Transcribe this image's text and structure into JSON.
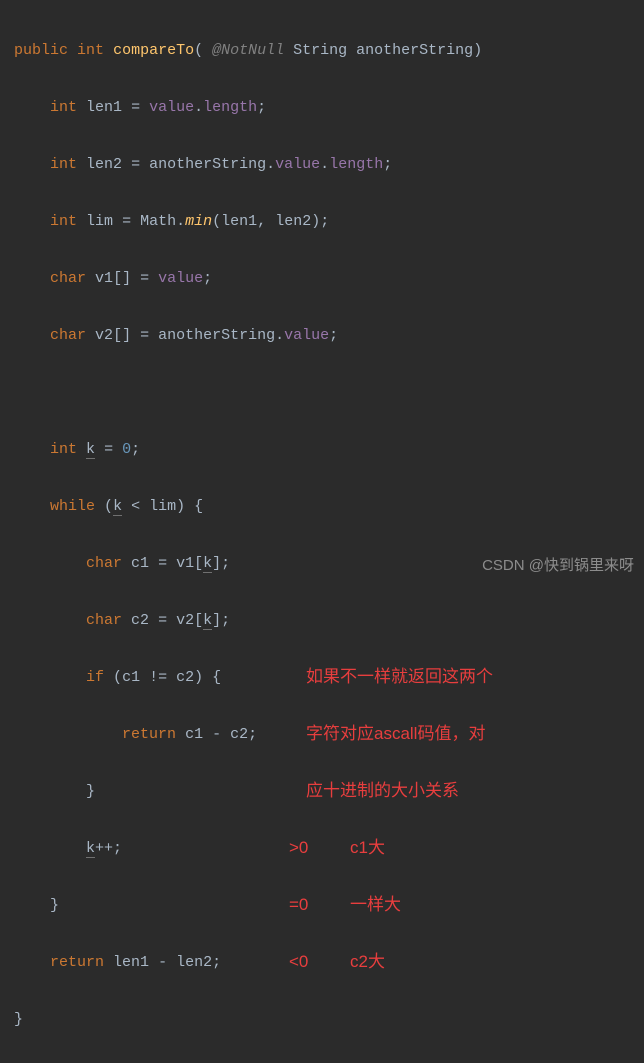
{
  "code": {
    "sig": {
      "public": "public",
      "int": "int",
      "name": "compareTo",
      "anno": "@NotNull",
      "ptype": "String",
      "pname": "anotherString"
    },
    "l1": {
      "type": "int",
      "var": "len1",
      "field": "value",
      "prop": "length"
    },
    "l2": {
      "type": "int",
      "var": "len2",
      "p": "anotherString",
      "field": "value",
      "prop": "length"
    },
    "l3": {
      "type": "int",
      "var": "lim",
      "cls": "Math",
      "m": "min",
      "a1": "len1",
      "a2": "len2"
    },
    "l4": {
      "type": "char",
      "var": "v1",
      "field": "value"
    },
    "l5": {
      "type": "char",
      "var": "v2",
      "p": "anotherString",
      "field": "value"
    },
    "l6": {
      "type": "int",
      "var": "k",
      "val": "0"
    },
    "l7": {
      "kw": "while",
      "var": "k",
      "limv": "lim"
    },
    "l8": {
      "type": "char",
      "var": "c1",
      "arr": "v1",
      "idx": "k"
    },
    "l9": {
      "type": "char",
      "var": "c2",
      "arr": "v2",
      "idx": "k"
    },
    "l10": {
      "kw": "if",
      "a": "c1",
      "b": "c2"
    },
    "l11": {
      "kw": "return",
      "a": "c1",
      "b": "c2"
    },
    "l12": {
      "var": "k"
    },
    "l13": {
      "kw": "return",
      "a": "len1",
      "b": "len2"
    }
  },
  "notes": {
    "n1": "如果不一样就返回这两个",
    "n2": "字符对应ascall码值，对",
    "n3": "应十进制的大小关系",
    "r1a": ">0",
    "r1b": "c1大",
    "r2a": "=0",
    "r2b": "一样大",
    "r3a": "<0",
    "r3b": "c2大"
  },
  "watermark": "CSDN @快到锅里来呀"
}
